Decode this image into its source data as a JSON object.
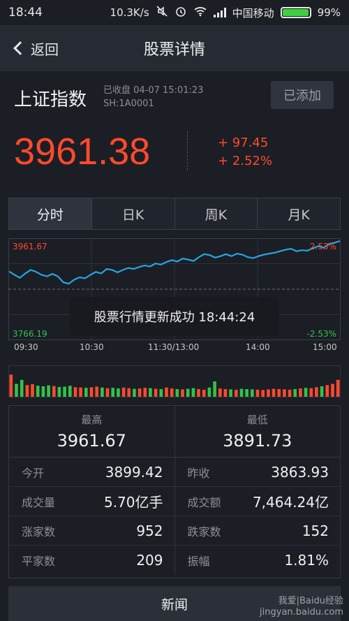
{
  "status_bar": {
    "time": "18:44",
    "network_speed": "10.3K/s",
    "carrier": "中国移动",
    "battery_percent": "99%",
    "battery_level": 0.99,
    "icons": [
      "mute-icon",
      "alarm-icon",
      "wifi-icon",
      "signal-icon",
      "battery-icon"
    ]
  },
  "nav": {
    "back_label": "返回",
    "title": "股票详情"
  },
  "stock": {
    "name": "上证指数",
    "status_line": "已收盘 04-07 15:01:23",
    "code": "SH:1A0001",
    "add_label": "已添加",
    "price": "3961.38",
    "change_abs": "+ 97.45",
    "change_pct": "+ 2.52%"
  },
  "tabs": [
    "分时",
    "日K",
    "周K",
    "月K"
  ],
  "active_tab": 0,
  "colors": {
    "up": "#ff4a2c",
    "down": "#33c24a",
    "line": "#25a7e0",
    "background": "#1b1e25"
  },
  "chart_data": {
    "type": "line",
    "x_ticks": [
      "09:30",
      "10:30",
      "11:30/13:00",
      "14:00",
      "15:00"
    ],
    "y_max_label": "3961.67",
    "y_min_label": "3766.19",
    "pct_max_label": "2.53%",
    "pct_min_label": "-2.53%",
    "prev_close": 3863.93,
    "ylim": [
      3766.19,
      3961.67
    ],
    "y": [
      3900,
      3893,
      3887,
      3896,
      3903,
      3899,
      3893,
      3890,
      3895,
      3890,
      3878,
      3875,
      3883,
      3888,
      3886,
      3893,
      3899,
      3896,
      3905,
      3903,
      3898,
      3903,
      3907,
      3905,
      3909,
      3912,
      3910,
      3916,
      3914,
      3919,
      3923,
      3920,
      3926,
      3924,
      3921,
      3929,
      3935,
      3933,
      3928,
      3931,
      3935,
      3931,
      3936,
      3934,
      3929,
      3927,
      3931,
      3934,
      3936,
      3938,
      3941,
      3944,
      3946,
      3941,
      3943,
      3942,
      3947,
      3951,
      3948,
      3956,
      3958,
      3961.67
    ],
    "volume": [
      0.72,
      0.42,
      0.55,
      0.38,
      0.41,
      0.36,
      0.34,
      0.37,
      0.35,
      0.32,
      0.33,
      0.36,
      0.31,
      0.3,
      0.29,
      0.31,
      0.33,
      0.3,
      0.28,
      0.29,
      0.27,
      0.3,
      0.28,
      0.26,
      0.27,
      0.29,
      0.28,
      0.26,
      0.25,
      0.3,
      0.27,
      0.25,
      0.24,
      0.26,
      0.28,
      0.25,
      0.23,
      0.3,
      0.5,
      0.27,
      0.25,
      0.24,
      0.23,
      0.26,
      0.25,
      0.24,
      0.23,
      0.22,
      0.24,
      0.26,
      0.25,
      0.24,
      0.23,
      0.25,
      0.27,
      0.29,
      0.28,
      0.31,
      0.34,
      0.38,
      0.42,
      0.55
    ]
  },
  "toast": "股票行情更新成功 18:44:24",
  "stats": {
    "high_label": "最高",
    "high_value": "3961.67",
    "low_label": "最低",
    "low_value": "3891.73",
    "rows": [
      {
        "l_label": "今开",
        "l_value": "3899.42",
        "r_label": "昨收",
        "r_value": "3863.93"
      },
      {
        "l_label": "成交量",
        "l_value": "5.70亿手",
        "r_label": "成交额",
        "r_value": "7,464.24亿"
      },
      {
        "l_label": "涨家数",
        "l_value": "952",
        "r_label": "跌家数",
        "r_value": "152"
      },
      {
        "l_label": "平家数",
        "l_value": "209",
        "r_label": "振幅",
        "r_value": "1.81%"
      }
    ]
  },
  "news_label": "新闻",
  "watermark": {
    "line1": "我爱|Baidu经验",
    "line2": "jingyan.baidu.com"
  }
}
